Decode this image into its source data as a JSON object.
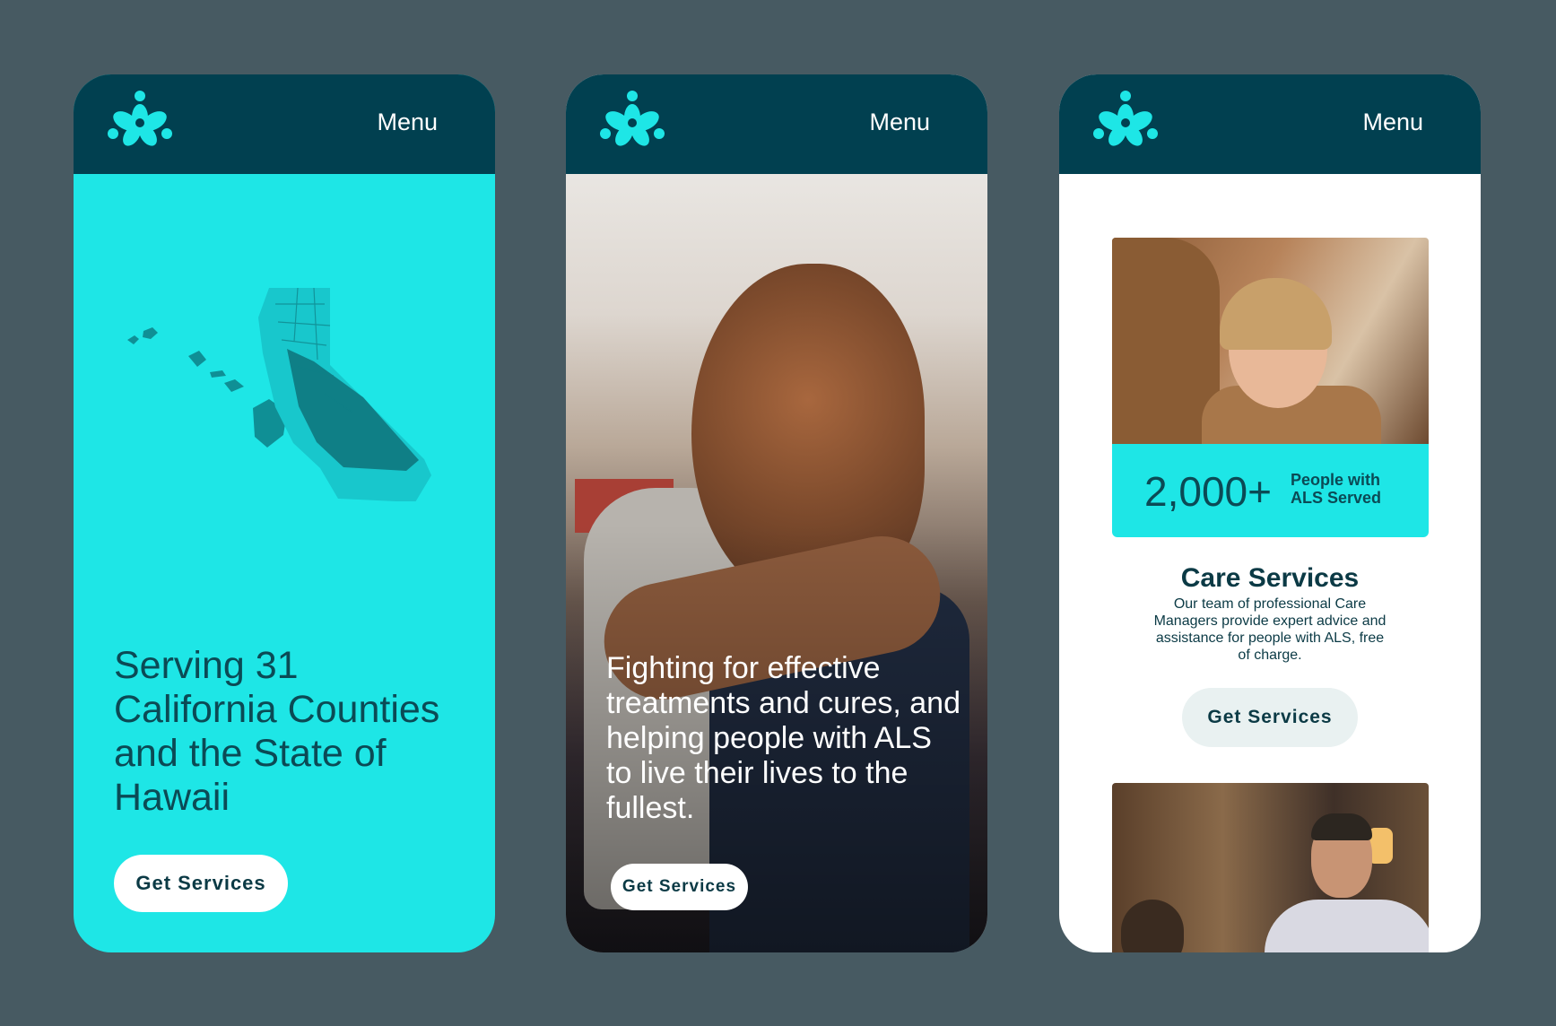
{
  "colors": {
    "background": "#475a62",
    "header": "#014050",
    "accent": "#1ee6e6",
    "text_dark": "#0b4a55"
  },
  "phones": [
    {
      "header": {
        "logo": "flower-logo",
        "menu_label": "Menu"
      },
      "hero": {
        "headline": "Serving 31 California Counties and the State of Hawaii",
        "cta": "Get Services"
      }
    },
    {
      "header": {
        "logo": "flower-logo",
        "menu_label": "Menu"
      },
      "hero": {
        "headline": "Fighting for effective treatments and cures, and helping people with ALS to live their lives to the fullest.",
        "cta": "Get Services"
      }
    },
    {
      "header": {
        "logo": "flower-logo",
        "menu_label": "Menu"
      },
      "stat": {
        "number": "2,000+",
        "label": "People with ALS Served"
      },
      "care": {
        "title": "Care Services",
        "body": "Our team of professional Care Managers provide expert advice and assistance for people with ALS, free of charge.",
        "cta": "Get Services"
      }
    }
  ]
}
